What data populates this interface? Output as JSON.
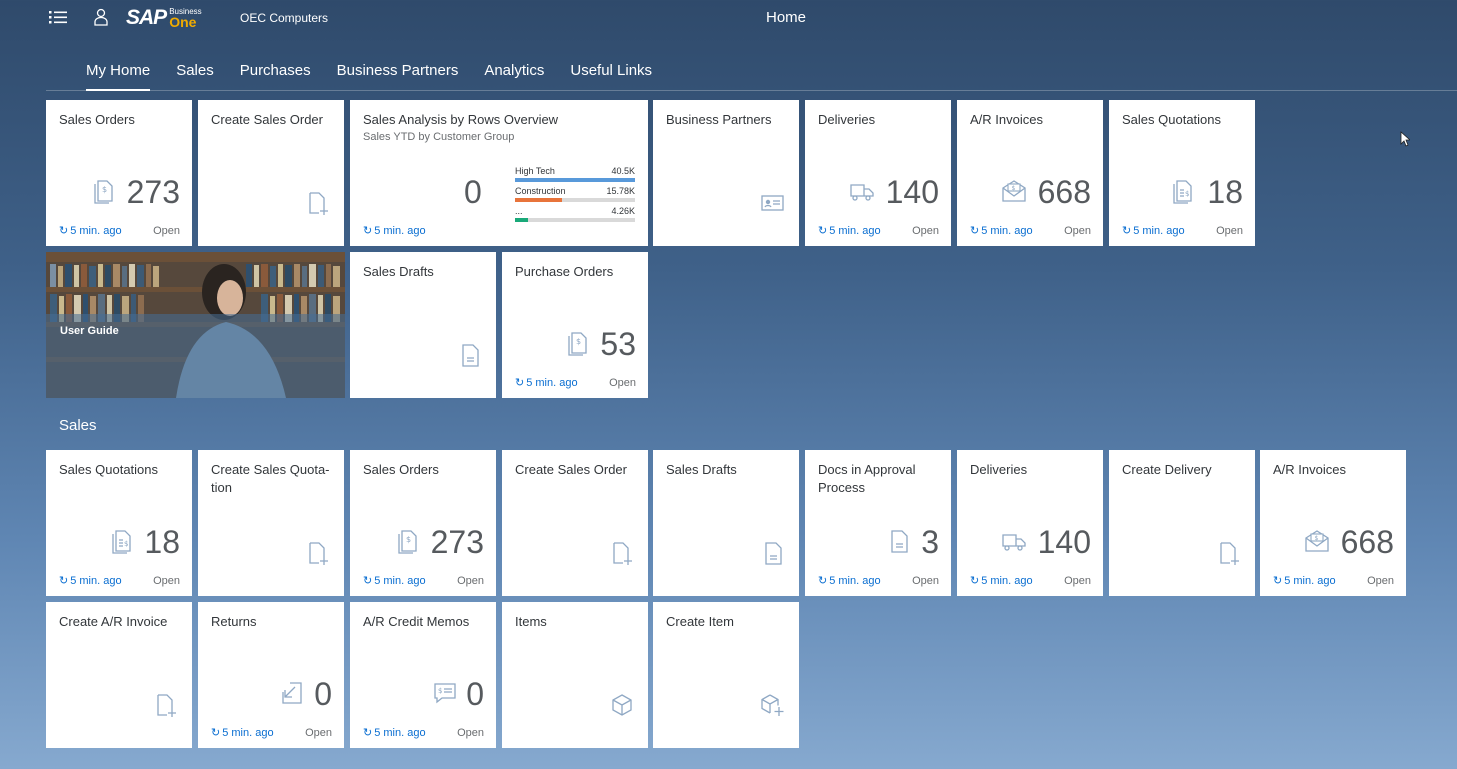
{
  "shell": {
    "brand_main": "SAP",
    "brand_sub": "Business",
    "brand_product": "One",
    "company": "OEC Computers",
    "title": "Home"
  },
  "tabs": [
    {
      "label": "My Home"
    },
    {
      "label": "Sales"
    },
    {
      "label": "Purchases"
    },
    {
      "label": "Business Partners"
    },
    {
      "label": "Analytics"
    },
    {
      "label": "Useful Links"
    }
  ],
  "colors": {
    "accent": "#0a6ed1",
    "icon": "#8fa8c4",
    "bar_blue": "#5899da",
    "bar_orange": "#e8743b",
    "bar_green": "#19a979"
  },
  "home": {
    "sales_orders": {
      "title": "Sales Orders",
      "kpi": "273",
      "time": "5 min. ago",
      "status": "Open",
      "icon": "document-dollar-icon"
    },
    "create_sales_order": {
      "title": "Create Sales Order",
      "icon": "add-document-icon"
    },
    "sales_analysis": {
      "title": "Sales Analysis by Rows Overview",
      "subtitle": "Sales YTD by Customer Group",
      "kpi": "0",
      "time": "5 min. ago",
      "bars": [
        {
          "label": "High Tech",
          "value": "40.5K",
          "fraction": 1.0,
          "color": "#5899da"
        },
        {
          "label": "Construction",
          "value": "15.78K",
          "fraction": 0.39,
          "color": "#e8743b"
        },
        {
          "label": "...",
          "value": "4.26K",
          "fraction": 0.105,
          "color": "#19a979"
        }
      ]
    },
    "business_partners": {
      "title": "Business Partners",
      "icon": "business-card-icon"
    },
    "deliveries": {
      "title": "Deliveries",
      "kpi": "140",
      "time": "5 min. ago",
      "status": "Open",
      "icon": "truck-icon"
    },
    "ar_invoices": {
      "title": "A/R Invoices",
      "kpi": "668",
      "time": "5 min. ago",
      "status": "Open",
      "icon": "envelope-dollar-icon"
    },
    "sales_quotations": {
      "title": "Sales Quotations",
      "kpi": "18",
      "time": "5 min. ago",
      "status": "Open",
      "icon": "quotation-icon"
    },
    "user_guide": {
      "label": "User Guide"
    },
    "sales_drafts": {
      "title": "Sales Drafts",
      "icon": "document-icon"
    },
    "purchase_orders": {
      "title": "Purchase Orders",
      "kpi": "53",
      "time": "5 min. ago",
      "status": "Open",
      "icon": "document-dollar-icon"
    }
  },
  "sales_section": {
    "title": "Sales",
    "quotations": {
      "title": "Sales Quotations",
      "kpi": "18",
      "time": "5 min. ago",
      "status": "Open"
    },
    "create_quotation": {
      "title": "Create Sales Quota-tion"
    },
    "orders": {
      "title": "Sales Orders",
      "kpi": "273",
      "time": "5 min. ago",
      "status": "Open"
    },
    "create_order": {
      "title": "Create Sales Order"
    },
    "drafts": {
      "title": "Sales Drafts"
    },
    "docs_approval": {
      "title": "Docs in Approval Process",
      "kpi": "3",
      "time": "5 min. ago",
      "status": "Open"
    },
    "deliveries": {
      "title": "Deliveries",
      "kpi": "140",
      "time": "5 min. ago",
      "status": "Open"
    },
    "create_delivery": {
      "title": "Create Delivery"
    },
    "ar_invoices": {
      "title": "A/R Invoices",
      "kpi": "668",
      "time": "5 min. ago",
      "status": "Open"
    },
    "create_ar_invoice": {
      "title": "Create A/R Invoice"
    },
    "returns": {
      "title": "Returns",
      "kpi": "0",
      "time": "5 min. ago",
      "status": "Open"
    },
    "credit_memos": {
      "title": "A/R Credit Memos",
      "kpi": "0",
      "time": "5 min. ago",
      "status": "Open"
    },
    "items": {
      "title": "Items"
    },
    "create_item": {
      "title": "Create Item"
    }
  }
}
